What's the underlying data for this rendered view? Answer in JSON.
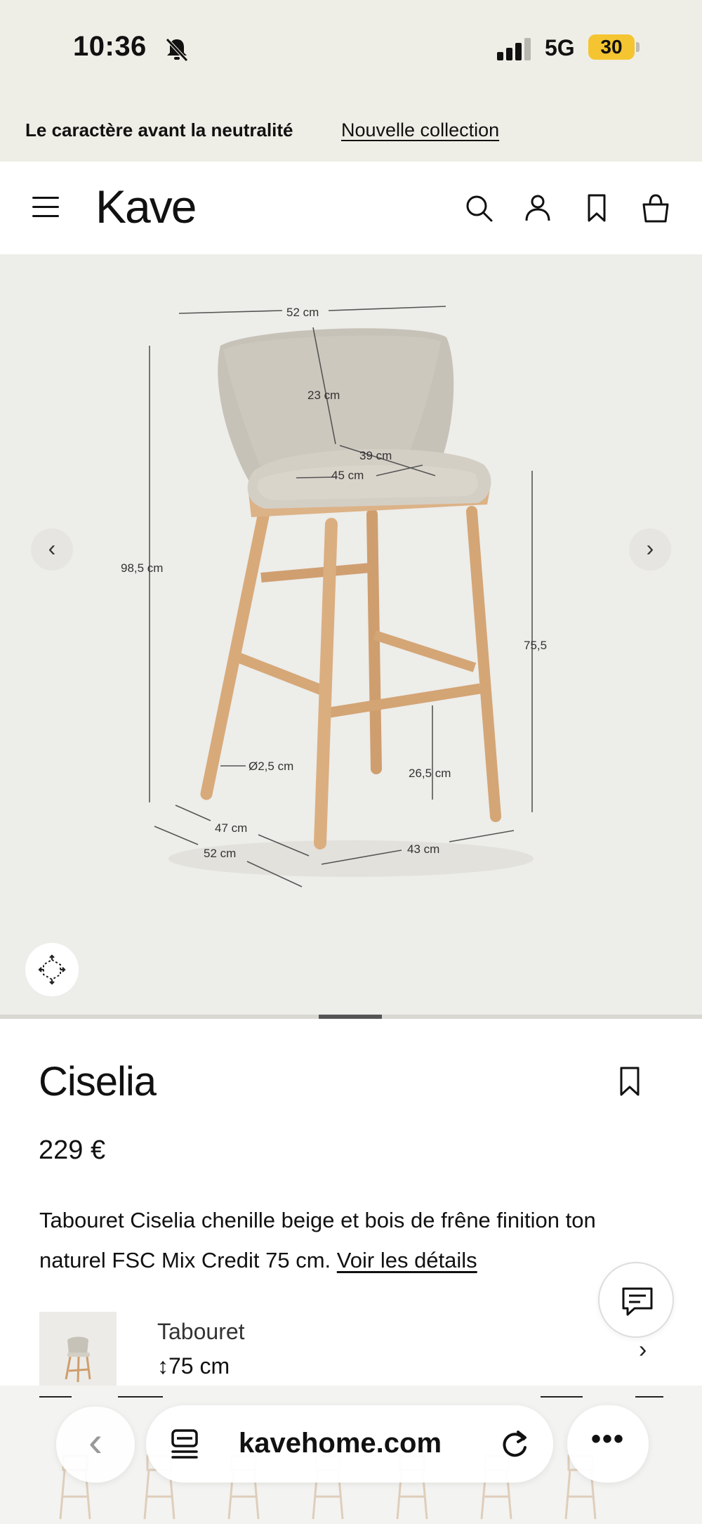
{
  "status_bar": {
    "time": "10:36",
    "network": "5G",
    "battery": "30"
  },
  "promo": {
    "text": "Le caractère avant la neutralité",
    "link": "Nouvelle collection"
  },
  "header": {
    "logo": "Kave"
  },
  "gallery": {
    "prev_label": "‹",
    "next_label": "›",
    "dimensions": {
      "width_top": "52 cm",
      "backrest_height": "23 cm",
      "seat_depth": "39 cm",
      "seat_width": "45 cm",
      "total_height": "98,5 cm",
      "seat_height": "75,5",
      "leg_diameter": "Ø2,5 cm",
      "footrest_height": "26,5 cm",
      "depth_inner": "47 cm",
      "depth_outer": "52 cm",
      "base_width": "43 cm"
    }
  },
  "product": {
    "name": "Ciselia",
    "price": "229 €",
    "description": "Tabouret Ciselia chenille beige et bois de frêne finition ton naturel FSC Mix Credit 75 cm.",
    "details_link": "Voir les détails"
  },
  "variant": {
    "type": "Tabouret",
    "size": "↕75 cm",
    "chevron": "›"
  },
  "browser": {
    "url": "kavehome.com",
    "back": "‹",
    "more": "•••"
  }
}
